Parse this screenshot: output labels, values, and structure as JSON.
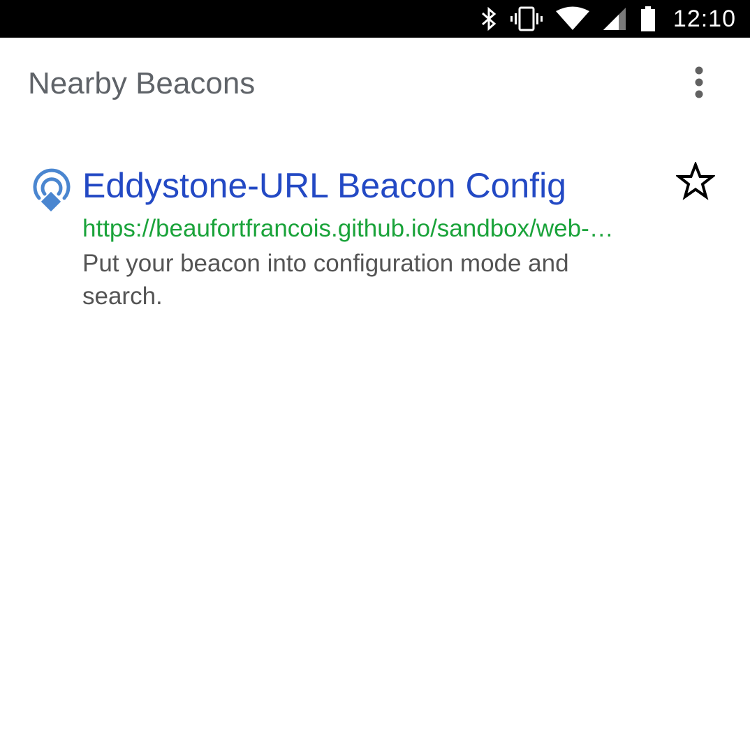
{
  "status_bar": {
    "time": "12:10",
    "icons": [
      "bluetooth-icon",
      "vibrate-icon",
      "wifi-icon",
      "cell-signal-icon",
      "battery-icon"
    ]
  },
  "app_bar": {
    "title": "Nearby Beacons",
    "overflow_icon": "more-vert-icon"
  },
  "beacons": [
    {
      "icon": "beacon-icon",
      "title": "Eddystone-URL Beacon Config",
      "url": "https://beaufortfrancois.github.io/sandbox/web-…",
      "description": "Put your beacon into configuration mode and search.",
      "star_icon": "star-outline-icon"
    }
  ],
  "colors": {
    "status_bar_bg": "#000000",
    "title_text": "#5f6368",
    "link_blue": "#2349c4",
    "url_green": "#1aa33a",
    "desc_gray": "#545454",
    "beacon_icon_blue": "#4a86d0"
  }
}
